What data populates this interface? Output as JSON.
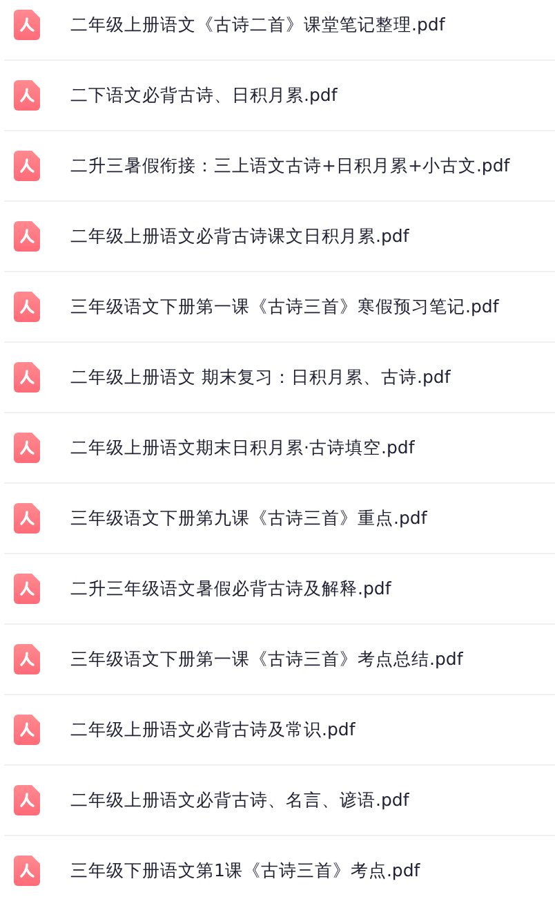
{
  "files": [
    {
      "name": "二年级上册语文《古诗二首》课堂笔记整理.pdf"
    },
    {
      "name": "二下语文必背古诗、日积月累.pdf"
    },
    {
      "name": "二升三暑假衔接：三上语文古诗+日积月累+小古文.pdf"
    },
    {
      "name": "二年级上册语文必背古诗课文日积月累.pdf"
    },
    {
      "name": "三年级语文下册第一课《古诗三首》寒假预习笔记.pdf"
    },
    {
      "name": "二年级上册语文 期末复习：日积月累、古诗.pdf"
    },
    {
      "name": "二年级上册语文期末日积月累·古诗填空.pdf"
    },
    {
      "name": "三年级语文下册第九课《古诗三首》重点.pdf"
    },
    {
      "name": "二升三年级语文暑假必背古诗及解释.pdf"
    },
    {
      "name": "三年级语文下册第一课《古诗三首》考点总结.pdf"
    },
    {
      "name": "二年级上册语文必背古诗及常识.pdf"
    },
    {
      "name": "二年级上册语文必背古诗、名言、谚语.pdf"
    },
    {
      "name": "三年级下册语文第1课《古诗三首》考点.pdf"
    }
  ]
}
